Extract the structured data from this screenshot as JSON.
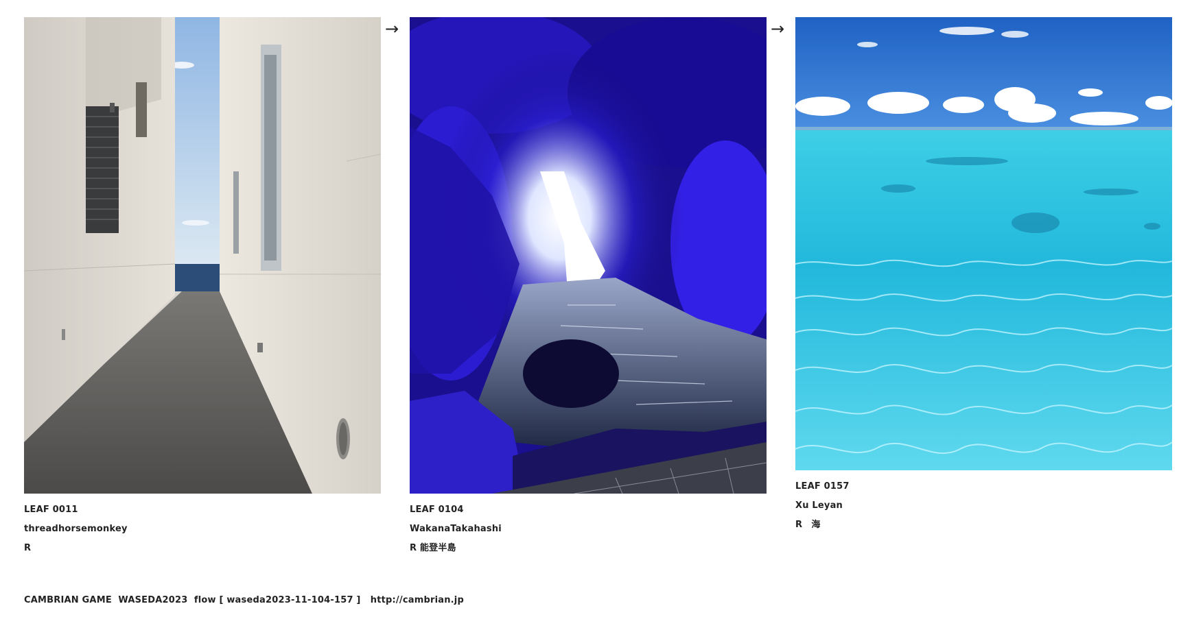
{
  "leaves": [
    {
      "id": "LEAF 0011",
      "author": "threadhorsemonkey",
      "caption": "R",
      "image_description": "narrow concrete passage between two pale buildings leading toward the sea under a blue sky"
    },
    {
      "id": "LEAF 0104",
      "author": "WakanaTakahashi",
      "caption": "R 能登半島",
      "image_description": "sea cave lit in deep blue with bright sunlight at the opening and water flowing inside"
    },
    {
      "id": "LEAF 0157",
      "author": "Xu Leyan",
      "caption": "R　海",
      "image_description": "clear turquoise sea water with ripples under a blue sky with white clouds"
    }
  ],
  "arrows": [
    "→",
    "→"
  ],
  "footer": {
    "text": "CAMBRIAN GAME  WASEDA2023  flow [ waseda2023-11-104-157 ]   http://cambrian.jp"
  }
}
